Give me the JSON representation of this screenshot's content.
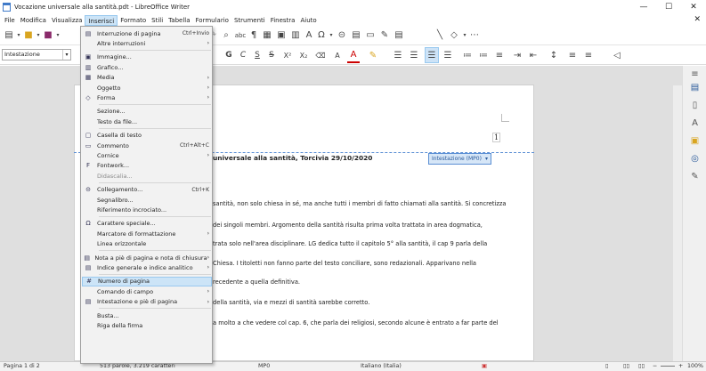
{
  "window": {
    "title": "Vocazione universale alla santità.pdt - LibreOffice Writer",
    "controls": [
      "—",
      "☐",
      "✕"
    ]
  },
  "menubar": {
    "items": [
      "File",
      "Modifica",
      "Visualizza",
      "Inserisci",
      "Formato",
      "Stili",
      "Tabella",
      "Formulario",
      "Strumenti",
      "Finestra",
      "Aiuto"
    ]
  },
  "formatting": {
    "paragraph_style": "Intestazione",
    "bold": "G",
    "italic": "C",
    "strike": "S",
    "font_color_letter": "A"
  },
  "insert_menu": [
    {
      "label": "Interruzione di pagina",
      "shortcut": "Ctrl+Invio",
      "icon": "page-break-icon"
    },
    {
      "label": "Altre interruzioni",
      "submenu": true
    },
    {
      "sep": true
    },
    {
      "label": "Immagine...",
      "icon": "image-icon"
    },
    {
      "label": "Grafico...",
      "icon": "chart-icon"
    },
    {
      "label": "Media",
      "submenu": true,
      "icon": "media-icon"
    },
    {
      "label": "Oggetto",
      "submenu": true
    },
    {
      "label": "Forma",
      "submenu": true,
      "icon": "shape-icon"
    },
    {
      "sep": true
    },
    {
      "label": "Sezione..."
    },
    {
      "label": "Testo da file..."
    },
    {
      "sep": true
    },
    {
      "label": "Casella di testo",
      "icon": "textbox-icon"
    },
    {
      "label": "Commento",
      "shortcut": "Ctrl+Alt+C",
      "icon": "comment-icon"
    },
    {
      "label": "Cornice",
      "submenu": true
    },
    {
      "label": "Fontwork...",
      "icon": "fontwork-icon"
    },
    {
      "label": "Didascalia...",
      "disabled": true
    },
    {
      "sep": true
    },
    {
      "label": "Collegamento...",
      "shortcut": "Ctrl+K",
      "icon": "hyperlink-icon"
    },
    {
      "label": "Segnalibro..."
    },
    {
      "label": "Riferimento incrociato..."
    },
    {
      "sep": true
    },
    {
      "label": "Carattere speciale...",
      "icon": "omega-icon"
    },
    {
      "label": "Marcatore di formattazione",
      "submenu": true
    },
    {
      "label": "Linea orizzontale"
    },
    {
      "sep": true
    },
    {
      "label": "Nota a piè di pagina e nota di chiusura",
      "submenu": true,
      "icon": "footnote-icon"
    },
    {
      "label": "Indice generale e indice analitico",
      "submenu": true,
      "icon": "index-icon"
    },
    {
      "sep": true
    },
    {
      "label": "Numero di pagina",
      "highlighted": true,
      "icon": "page-number-icon"
    },
    {
      "label": "Comando di campo",
      "submenu": true
    },
    {
      "label": "Intestazione e piè di pagina",
      "submenu": true,
      "icon": "header-footer-icon"
    },
    {
      "sep": true
    },
    {
      "label": "Busta..."
    },
    {
      "label": "Riga della firma"
    }
  ],
  "document": {
    "page_number": "1",
    "header_tag": "Intestazione (MP0)",
    "heading": "universale alla santità, Torcivia 29/10/2020",
    "lines": [
      "santità, non solo chiesa in sé, ma anche tutti i membri di fatto chiamati alla santità. Si concretizza",
      "dei singoli membri. Argomento della santità risulta prima volta trattata in area dogmatica,",
      "trata solo nell'area disciplinare. LG dedica tutto il capitolo 5° alla santità, il cap 9 parla della",
      "Chiesa. I titoletti non fanno parte del testo conciliare, sono redazionali. Apparivano nella",
      "recedente a quella definitiva.",
      "della santità, via e mezzi di santità sarebbe corretto.",
      "a molto a che vedere col cap. 6, che parla dei religiosi, secondo alcune è entrato a far parte del"
    ]
  },
  "statusbar": {
    "page": "Pagina 1 di 2",
    "words": "513 parole, 3.219 caratteri",
    "page_style": "MP0",
    "language": "Italiano (Italia)",
    "zoom": "100%"
  }
}
